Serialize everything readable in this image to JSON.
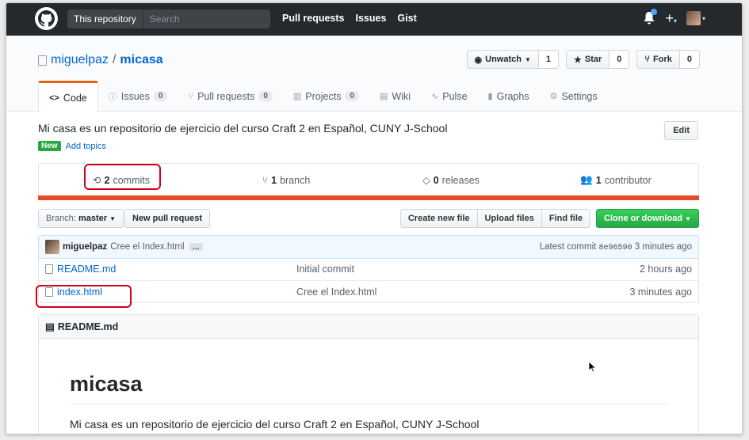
{
  "header": {
    "scope_label": "This repository",
    "search_placeholder": "Search",
    "nav": [
      "Pull requests",
      "Issues",
      "Gist"
    ],
    "plus": "+",
    "caret": "▾"
  },
  "repo": {
    "owner": "miguelpaz",
    "separator": "/",
    "name": "micasa",
    "actions": {
      "watch_label": "Unwatch",
      "watch_count": "1",
      "star_label": "Star",
      "star_count": "0",
      "fork_label": "Fork",
      "fork_count": "0"
    },
    "tabs": [
      {
        "label": "Code",
        "icon": "<>",
        "count": ""
      },
      {
        "label": "Issues",
        "icon": "ⓘ",
        "count": "0"
      },
      {
        "label": "Pull requests",
        "icon": "⑂",
        "count": "0"
      },
      {
        "label": "Projects",
        "icon": "▥",
        "count": "0"
      },
      {
        "label": "Wiki",
        "icon": "▤",
        "count": ""
      },
      {
        "label": "Pulse",
        "icon": "∿",
        "count": ""
      },
      {
        "label": "Graphs",
        "icon": "▮",
        "count": ""
      },
      {
        "label": "Settings",
        "icon": "⚙",
        "count": ""
      }
    ],
    "description": "Mi casa es un repositorio de ejercicio del curso Craft 2 en Español, CUNY J-School",
    "edit_label": "Edit",
    "new_badge": "New",
    "add_topics": "Add topics"
  },
  "summary": {
    "commits_num": "2",
    "commits_label": "commits",
    "branch_num": "1",
    "branch_label": "branch",
    "releases_num": "0",
    "releases_label": "releases",
    "contributor_num": "1",
    "contributor_label": "contributor",
    "language_color": "#e34c26"
  },
  "filenav": {
    "branch_prefix": "Branch:",
    "branch_name": "master",
    "new_pr": "New pull request",
    "create_file": "Create new file",
    "upload_files": "Upload files",
    "find_file": "Find file",
    "clone": "Clone or download"
  },
  "latest_commit": {
    "author": "miguelpaz",
    "message": "Cree el Index.html",
    "ellipsis": "…",
    "prefix": "Latest commit",
    "sha": "8e96590",
    "age": "3 minutes ago"
  },
  "files": [
    {
      "name": "README.md",
      "message": "Initial commit",
      "age": "2 hours ago"
    },
    {
      "name": "index.html",
      "message": "Cree el Index.html",
      "age": "3 minutes ago"
    }
  ],
  "readme": {
    "file_label": "README.md",
    "title": "micasa",
    "body": "Mi casa es un repositorio de ejercicio del curso Craft 2 en Español, CUNY J-School"
  },
  "colors": {
    "header_bg": "#24292e",
    "link": "#0366d6",
    "tab_accent": "#e36209",
    "clone_green": "#28a745",
    "annotation_red": "#d0021b"
  }
}
